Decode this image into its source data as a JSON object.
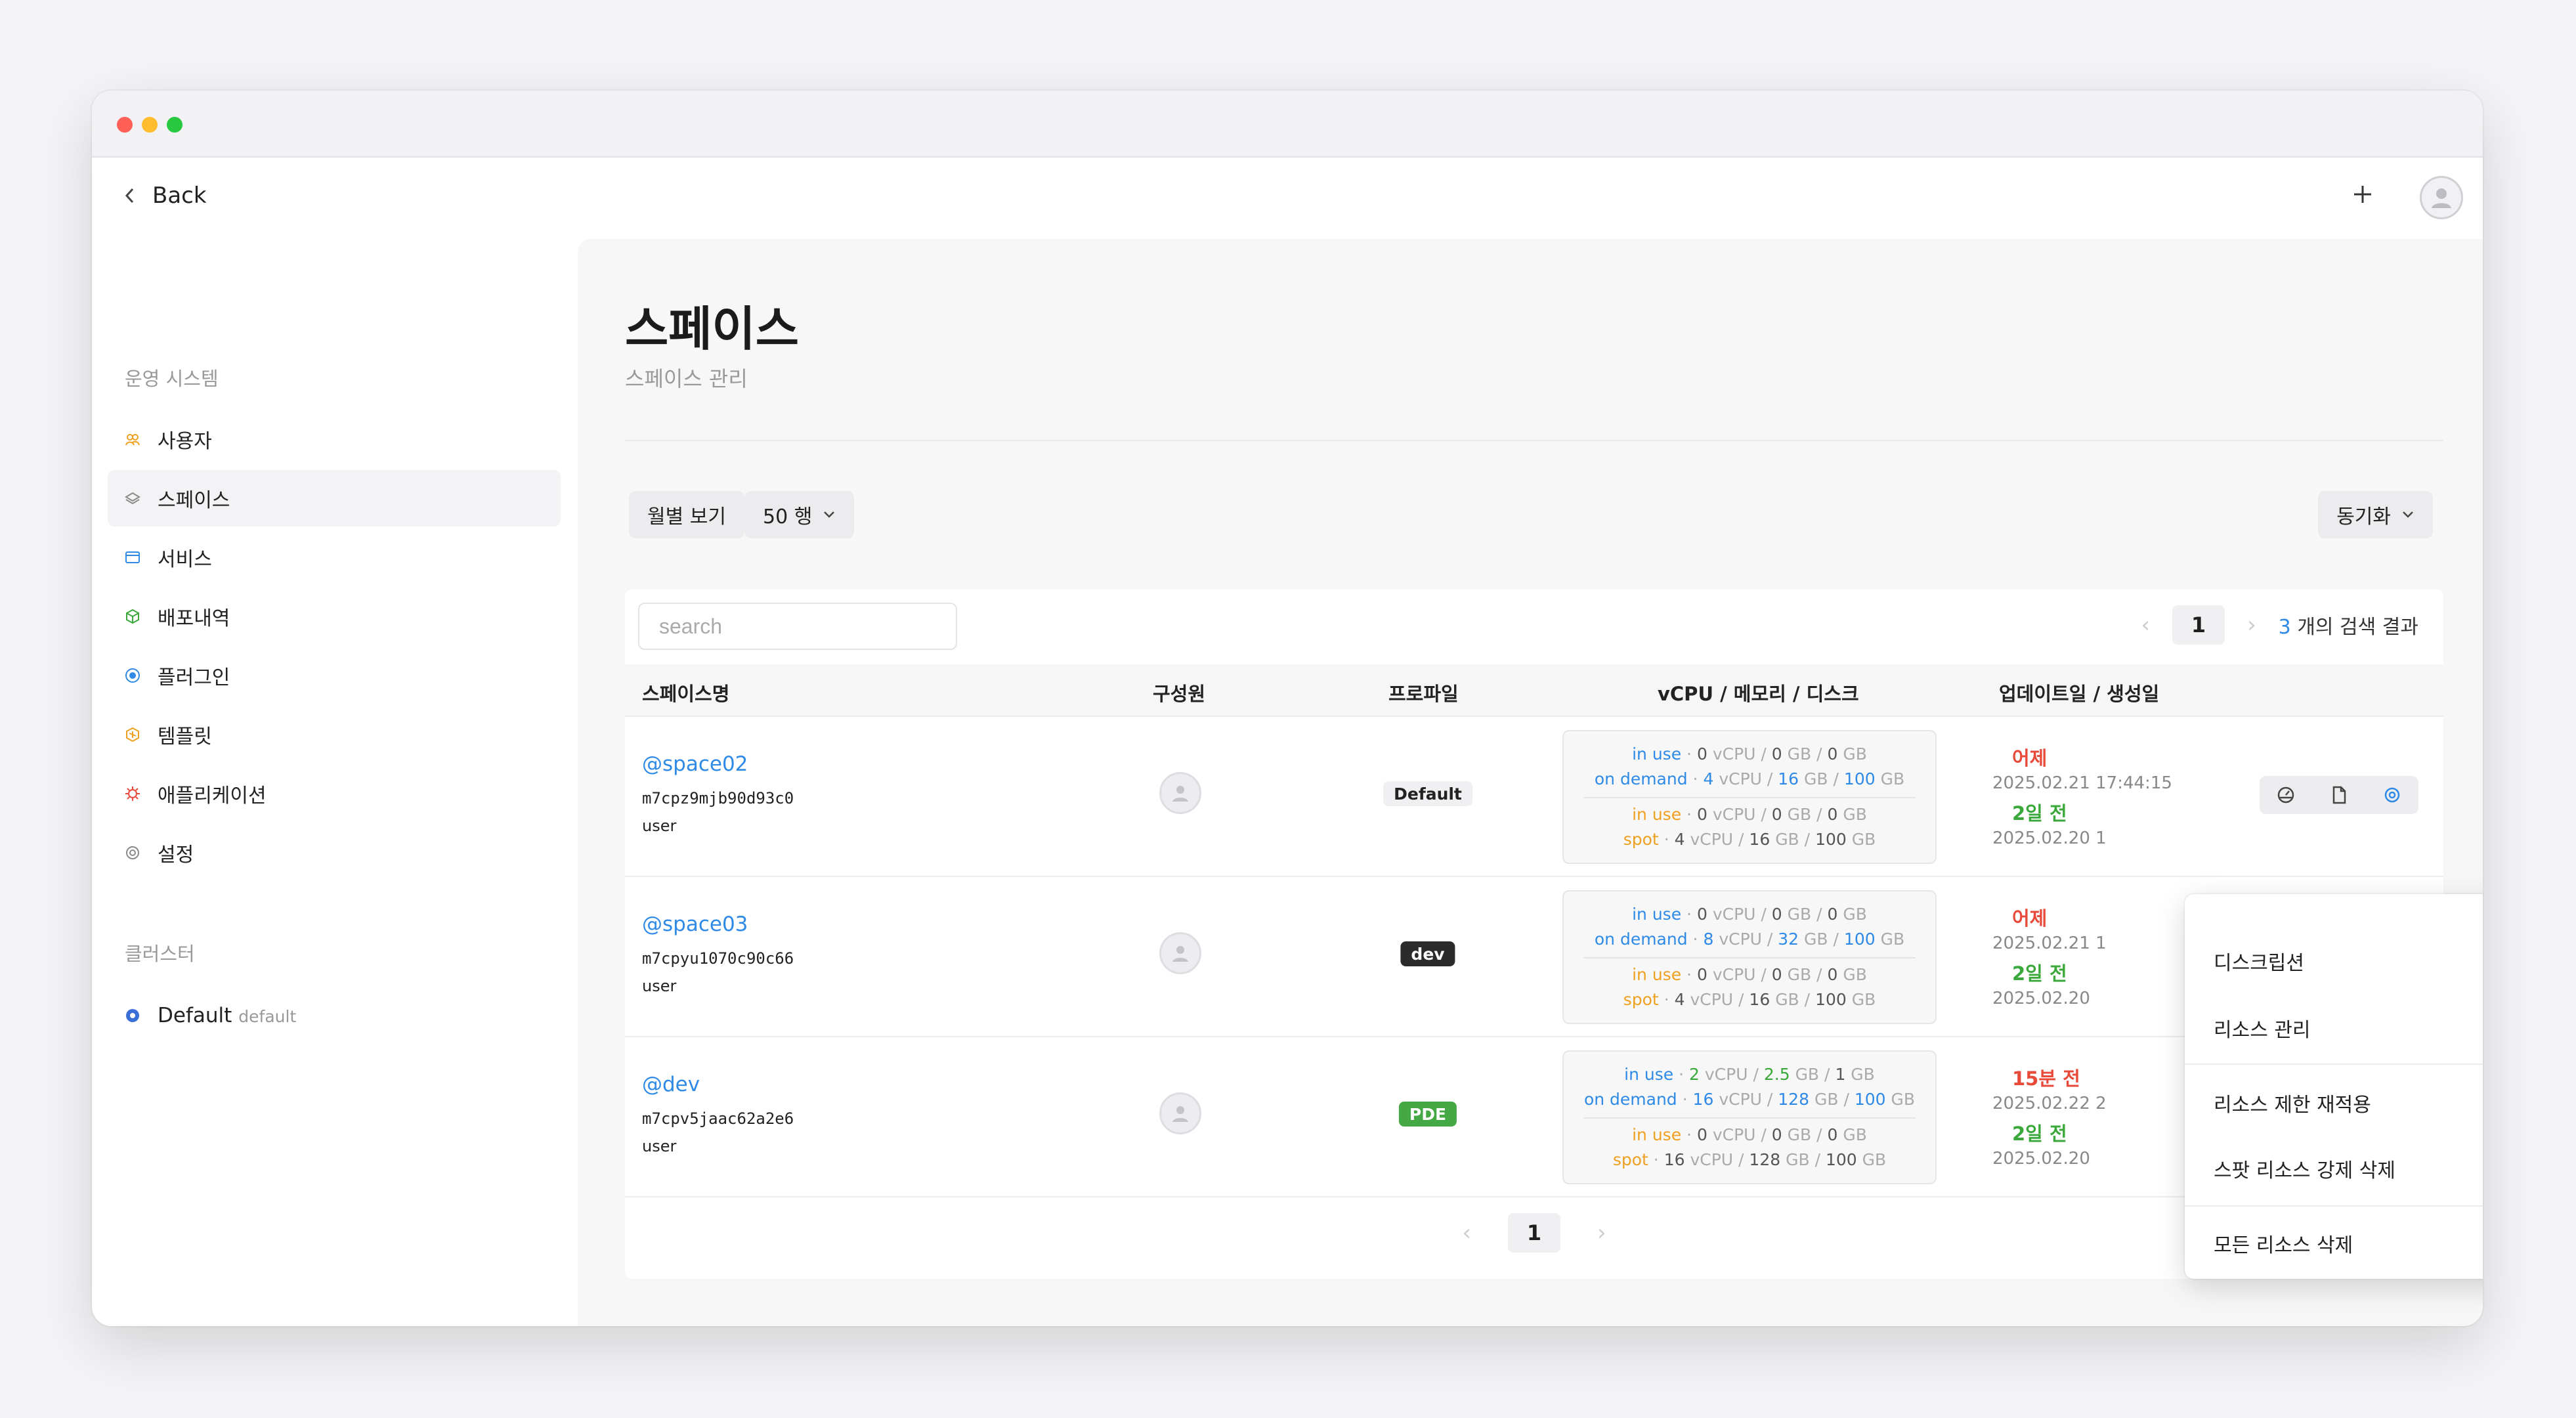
{
  "nav": {
    "back_label": "Back"
  },
  "sidebar": {
    "section_ops": "운영 시스템",
    "items": [
      {
        "label": "사용자",
        "icon": "users-icon",
        "color": "#f0a020"
      },
      {
        "label": "스페이스",
        "icon": "layers-icon",
        "color": "#8a8a8a"
      },
      {
        "label": "서비스",
        "icon": "window-icon",
        "color": "#2e8ae6"
      },
      {
        "label": "배포내역",
        "icon": "box-icon",
        "color": "#3aa83a"
      },
      {
        "label": "플러그인",
        "icon": "plugin-icon",
        "color": "#2e8ae6"
      },
      {
        "label": "템플릿",
        "icon": "template-icon",
        "color": "#f0a020"
      },
      {
        "label": "애플리케이션",
        "icon": "application-icon",
        "color": "#e84a3a"
      },
      {
        "label": "설정",
        "icon": "gear-icon",
        "color": "#8a8a8a"
      }
    ],
    "section_cluster": "클러스터",
    "cluster": {
      "label": "Default",
      "tag": "default"
    }
  },
  "page": {
    "title": "스페이스",
    "subtitle": "스페이스 관리"
  },
  "toolbar": {
    "monthly": "월별 보기",
    "rows": "50 행",
    "sync": "동기화"
  },
  "search": {
    "placeholder": "search"
  },
  "pagination": {
    "current": "1",
    "result_count": "3",
    "result_suffix": "개의 검색 결과"
  },
  "table": {
    "headers": [
      "스페이스명",
      "구성원",
      "프로파일",
      "vCPU / 메모리 / 디스크",
      "업데이트일 / 생성일"
    ],
    "rows": [
      {
        "name": "@space02",
        "id": "m7cpz9mjb90d93c0",
        "role": "user",
        "profile": "Default",
        "line1": {
          "label": "in use",
          "vcpu": "0",
          "mem": "0",
          "disk": "0"
        },
        "line2": {
          "label": "on demand",
          "vcpu": "4",
          "mem": "16",
          "disk": "100"
        },
        "line3": {
          "label": "in use",
          "vcpu": "0",
          "mem": "0",
          "disk": "0"
        },
        "line4": {
          "label": "spot",
          "vcpu": "4",
          "mem": "16",
          "disk": "100"
        },
        "updated_rel": "어제",
        "updated": "2025.02.21 17:44:15",
        "created_rel": "2일 전",
        "created": "2025.02.20 1"
      },
      {
        "name": "@space03",
        "id": "m7cpyu1070c90c66",
        "role": "user",
        "profile": "dev",
        "line1": {
          "label": "in use",
          "vcpu": "0",
          "mem": "0",
          "disk": "0"
        },
        "line2": {
          "label": "on demand",
          "vcpu": "8",
          "mem": "32",
          "disk": "100"
        },
        "line3": {
          "label": "in use",
          "vcpu": "0",
          "mem": "0",
          "disk": "0"
        },
        "line4": {
          "label": "spot",
          "vcpu": "4",
          "mem": "16",
          "disk": "100"
        },
        "updated_rel": "어제",
        "updated": "2025.02.21 1",
        "created_rel": "2일 전",
        "created": "2025.02.20"
      },
      {
        "name": "@dev",
        "id": "m7cpv5jaac62a2e6",
        "role": "user",
        "profile": "PDE",
        "line1": {
          "label": "in use",
          "vcpu": "2",
          "mem": "2.5",
          "disk": "1"
        },
        "line2": {
          "label": "on demand",
          "vcpu": "16",
          "mem": "128",
          "disk": "100"
        },
        "line3": {
          "label": "in use",
          "vcpu": "0",
          "mem": "0",
          "disk": "0"
        },
        "line4": {
          "label": "spot",
          "vcpu": "16",
          "mem": "128",
          "disk": "100"
        },
        "updated_rel": "15분 전",
        "updated": "2025.02.22 2",
        "created_rel": "2일 전",
        "created": "2025.02.20"
      }
    ]
  },
  "units": {
    "vcpu": "vCPU",
    "gb": "GB",
    "sep": "·",
    "slash": "/"
  },
  "menu": {
    "items": [
      "디스크립션",
      "리소스 관리",
      "리소스 제한 재적용",
      "스팟 리소스 강제 삭제",
      "모든 리소스 삭제"
    ]
  },
  "colors": {
    "accent": "#2e8ae6",
    "warning": "#f0a020",
    "danger": "#e84a3a",
    "success": "#3aa83a"
  }
}
